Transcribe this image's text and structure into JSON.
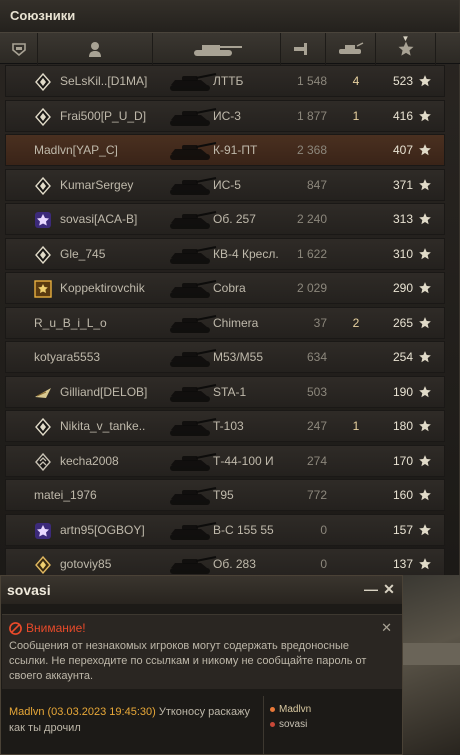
{
  "panel": {
    "title": "Союзники",
    "header_icons": [
      "platoon-icon",
      "player-icon",
      "tank-icon",
      "damage-icon",
      "frags-icon",
      "xp-star-icon"
    ]
  },
  "rows": [
    {
      "player": "SeLsKil..[D1MA]",
      "tank": "ЛТТБ",
      "damage": "1 548",
      "frags": "4",
      "xp": "523",
      "badge": "diamond"
    },
    {
      "player": "Frai500[P_U_D]",
      "tank": "ИС-3",
      "damage": "1 877",
      "frags": "1",
      "xp": "416",
      "badge": "diamond"
    },
    {
      "player": "Madlvn[YAP_C]",
      "tank": "К-91-ПТ",
      "damage": "2 368",
      "frags": "",
      "xp": "407",
      "badge": "",
      "highlight": true
    },
    {
      "player": "KumarSergey",
      "tank": "ИС-5",
      "damage": "847",
      "frags": "",
      "xp": "371",
      "badge": "diamond"
    },
    {
      "player": "sovasi[ACA-B]",
      "tank": "Об. 257",
      "damage": "2 240",
      "frags": "",
      "xp": "313",
      "badge": "purple"
    },
    {
      "player": "Gle_745",
      "tank": "КВ-4 Кресл.",
      "damage": "1 622",
      "frags": "",
      "xp": "310",
      "badge": "diamond"
    },
    {
      "player": "Koppektirovchik",
      "tank": "Cobra",
      "damage": "2 029",
      "frags": "",
      "xp": "290",
      "badge": "gold"
    },
    {
      "player": "R_u_B_i_L_o",
      "tank": "Chimera",
      "damage": "37",
      "frags": "2",
      "xp": "265",
      "badge": ""
    },
    {
      "player": "kotyara5553",
      "tank": "M53/M55",
      "damage": "634",
      "frags": "",
      "xp": "254",
      "badge": ""
    },
    {
      "player": "Gilliand[DELOB]",
      "tank": "STA-1",
      "damage": "503",
      "frags": "",
      "xp": "190",
      "badge": "wing"
    },
    {
      "player": "Nikita_v_tanke..",
      "tank": "T-103",
      "damage": "247",
      "frags": "1",
      "xp": "180",
      "badge": "diamond"
    },
    {
      "player": "kecha2008",
      "tank": "Т-44-100 И",
      "damage": "274",
      "frags": "",
      "xp": "170",
      "badge": "rank2"
    },
    {
      "player": "matei_1976",
      "tank": "T95",
      "damage": "772",
      "frags": "",
      "xp": "160",
      "badge": ""
    },
    {
      "player": "artn95[OGBOY]",
      "tank": "B-C 155 55",
      "damage": "0",
      "frags": "",
      "xp": "157",
      "badge": "purple"
    },
    {
      "player": "gotoviy85",
      "tank": "Об. 283",
      "damage": "0",
      "frags": "",
      "xp": "137",
      "badge": "gold-diamond"
    }
  ],
  "chat": {
    "title": "sovasi",
    "minimize_label": "—",
    "close_label": "✕",
    "warning_title": "Внимание!",
    "warning_text": "Сообщения от незнакомых игроков могут содержать вредоносные ссылки. Не переходите по ссылкам и никому не сообщайте пароль от своего аккаунта.",
    "warning_close": "✕",
    "message": {
      "author": "Madlvn (03.03.2023 19:45:30)",
      "text": "Утконосу раскажу как ты дрочил"
    },
    "members": [
      "Madlvn",
      "sovasi"
    ]
  },
  "colors": {
    "accent": "#e8a838",
    "warning": "#e84a2a",
    "highlight_row": "#4a3020"
  }
}
